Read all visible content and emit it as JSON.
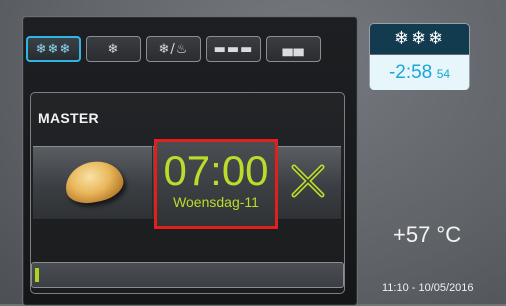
{
  "mode_tabs": [
    {
      "icon": "three-snowflakes-icon",
      "glyph": "❄❄❄",
      "active": true
    },
    {
      "icon": "snowflake-icon",
      "glyph": "❄",
      "active": false
    },
    {
      "icon": "snowflake-thaw-icon",
      "glyph": "❄/♨",
      "active": false
    },
    {
      "icon": "bread-tray-icon",
      "glyph": "▬▬▬",
      "active": false
    },
    {
      "icon": "loaf-icon",
      "glyph": "▄▄",
      "active": false
    }
  ],
  "master": {
    "label": "MASTER"
  },
  "program": {
    "time": "07:00",
    "day": "Woensdag-11",
    "accent": "#b9dd2a",
    "highlight": "#e0201b"
  },
  "progress": {
    "fraction": 0.01,
    "color": "#a9d422"
  },
  "freezer": {
    "icon": "❄❄❄",
    "value_main": "-2:58",
    "value_sec": "54",
    "accent": "#19a7d6"
  },
  "temperature": "+57 °C",
  "timestamp": "11:10 - 10/05/2016"
}
